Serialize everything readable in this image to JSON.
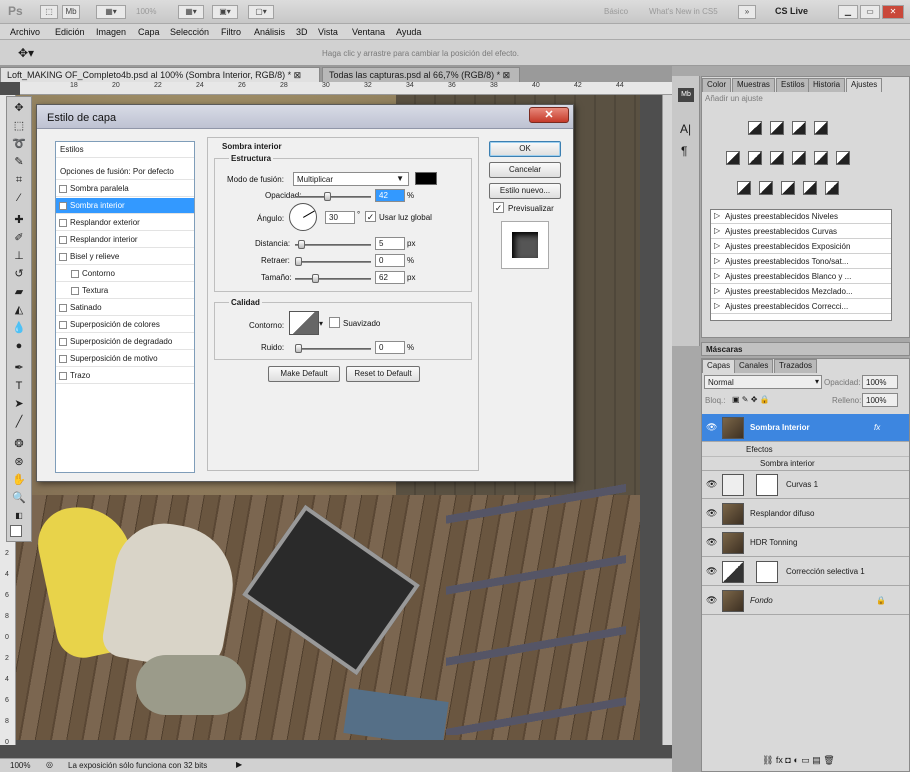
{
  "app": {
    "logo": "Ps",
    "zoom": "100%",
    "workspace_basic": "Básico",
    "whats_new": "What's New in CS5",
    "more": "»",
    "cslive": "CS Live"
  },
  "menu": [
    "Archivo",
    "Edición",
    "Imagen",
    "Capa",
    "Selección",
    "Filtro",
    "Análisis",
    "3D",
    "Vista",
    "Ventana",
    "Ayuda"
  ],
  "options": {
    "hint": "Haga clic y arrastre para cambiar la posición del efecto."
  },
  "tabs": [
    "Loft_MAKING OF_Completo4b.psd al 100% (Sombra Interior, RGB/8) *",
    "Todas las capturas.psd al 66,7% (RGB/8) *"
  ],
  "ruler": [
    "18",
    "20",
    "22",
    "24",
    "26",
    "28",
    "30",
    "32",
    "34",
    "36",
    "38",
    "40",
    "42",
    "44"
  ],
  "ruler_v": [
    "2",
    "4",
    "6",
    "8",
    "0",
    "2",
    "4",
    "6",
    "8",
    "0",
    "2",
    "4"
  ],
  "status": {
    "zoom": "100%",
    "message": "La exposición sólo funciona con 32 bits"
  },
  "adjust_tabs": [
    "Color",
    "Muestras",
    "Estilos",
    "Historia",
    "Ajustes"
  ],
  "adjust": {
    "title": "Añadir un ajuste",
    "presets": [
      "Ajustes preestablecidos Niveles",
      "Ajustes preestablecidos Curvas",
      "Ajustes preestablecidos Exposición",
      "Ajustes preestablecidos Tono/sat...",
      "Ajustes preestablecidos Blanco y ...",
      "Ajustes preestablecidos Mezclado...",
      "Ajustes preestablecidos Correcci..."
    ]
  },
  "masks": "Máscaras",
  "layers": {
    "tabs": [
      "Capas",
      "Canales",
      "Trazados"
    ],
    "blend": "Normal",
    "opacity_label": "Opacidad:",
    "opacity": "100%",
    "lock_label": "Bloq.:",
    "fill_label": "Relleno:",
    "fill": "100%",
    "items": [
      {
        "name": "Sombra Interior",
        "fx": "fx"
      },
      {
        "name": "Curvas 1"
      },
      {
        "name": "Resplandor difuso"
      },
      {
        "name": "HDR Tonning"
      },
      {
        "name": "Corrección selectiva 1"
      },
      {
        "name": "Fondo"
      }
    ],
    "effects_label": "Efectos",
    "effect_item": "Sombra interior"
  },
  "dialog": {
    "title": "Estilo de capa",
    "close": "✕",
    "styles": [
      {
        "label": "Estilos"
      },
      {
        "label": "Opciones de fusión: Por defecto"
      },
      {
        "label": "Sombra paralela"
      },
      {
        "label": "Sombra interior",
        "checked": "✓"
      },
      {
        "label": "Resplandor exterior"
      },
      {
        "label": "Resplandor interior"
      },
      {
        "label": "Bisel y relieve"
      },
      {
        "label": "Contorno"
      },
      {
        "label": "Textura"
      },
      {
        "label": "Satinado"
      },
      {
        "label": "Superposición de colores"
      },
      {
        "label": "Superposición de degradado"
      },
      {
        "label": "Superposición de motivo"
      },
      {
        "label": "Trazo"
      }
    ],
    "section": "Sombra interior",
    "structure": "Estructura",
    "blend_label": "Modo de fusión:",
    "blend_value": "Multiplicar",
    "blend_color": "#000000",
    "opacity_label": "Opacidad:",
    "opacity_value": "42",
    "opacity_pct": 0.42,
    "angle_label": "Ángulo:",
    "angle_value": "30",
    "deg": "°",
    "global_light": "Usar luz global",
    "distance_label": "Distancia:",
    "distance_value": "5",
    "distance_pct": 0.05,
    "choke_label": "Retraer:",
    "choke_value": "0",
    "choke_pct": 0,
    "size_label": "Tamaño:",
    "size_value": "62",
    "size_pct": 0.25,
    "unit_px": "px",
    "unit_pct": "%",
    "quality": "Calidad",
    "contour_label": "Contorno:",
    "antialias": "Suavizado",
    "noise_label": "Ruido:",
    "noise_value": "0",
    "noise_pct": 0,
    "make_default": "Make Default",
    "reset_default": "Reset to Default",
    "ok": "OK",
    "cancel": "Cancelar",
    "new_style": "Estilo nuevo...",
    "preview": "Previsualizar"
  }
}
